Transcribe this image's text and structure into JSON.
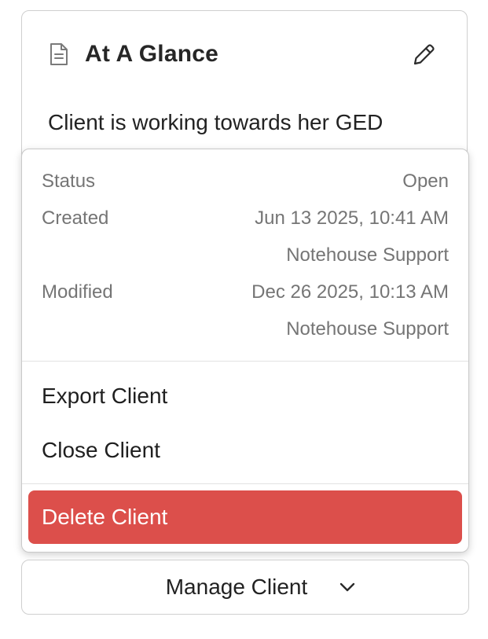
{
  "card": {
    "icon": "document-icon",
    "title": "At A Glance",
    "edit_icon": "pencil-icon",
    "body": "Client is working towards her GED"
  },
  "menu": {
    "status_label": "Status",
    "status_value": "Open",
    "created_label": "Created",
    "created_date": "Jun 13 2025, 10:41 AM",
    "created_by": "Notehouse Support",
    "modified_label": "Modified",
    "modified_date": "Dec 26 2025, 10:13 AM",
    "modified_by": "Notehouse Support",
    "export_label": "Export Client",
    "close_label": "Close Client",
    "delete_label": "Delete Client"
  },
  "manage": {
    "label": "Manage Client",
    "icon": "chevron-down-icon"
  },
  "colors": {
    "danger": "#dc4f4b",
    "muted_text": "#757575",
    "border": "#cfcfcf"
  }
}
